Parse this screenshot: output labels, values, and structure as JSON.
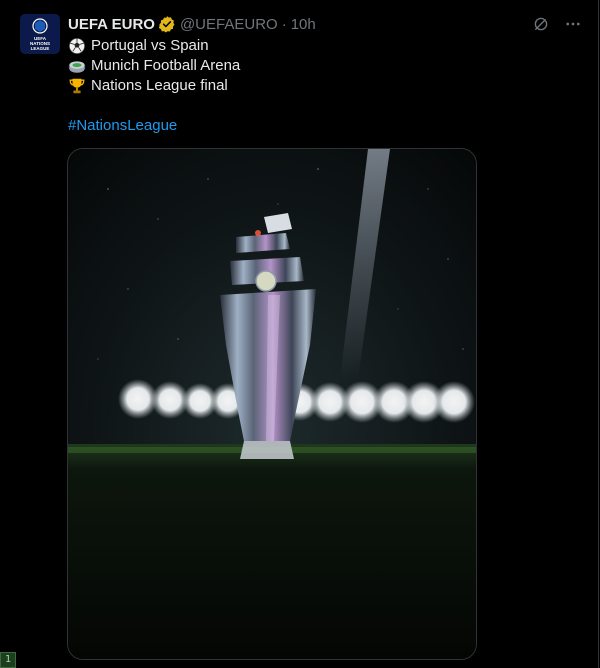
{
  "tweet": {
    "author_name": "UEFA EURO",
    "author_handle": "@UEFAEURO",
    "separator": "·",
    "time": "10h",
    "lines": [
      {
        "icon": "soccer-ball-icon",
        "text": "Portugal vs Spain"
      },
      {
        "icon": "stadium-icon",
        "text": "Munich Football Arena"
      },
      {
        "icon": "trophy-icon",
        "text": "Nations League final"
      }
    ],
    "hashtag": "#NationsLeague",
    "avatar_logo_text": "UEFA\nNATIONS\nLEAGUE"
  },
  "actions": [
    "grok-icon",
    "more-options-icon"
  ],
  "corner_badge": "1",
  "colors": {
    "background": "#000000",
    "text": "#e7e9ea",
    "muted": "#71767b",
    "link": "#1d9bf0",
    "verified": "#e2b719",
    "border": "#2f3336"
  }
}
